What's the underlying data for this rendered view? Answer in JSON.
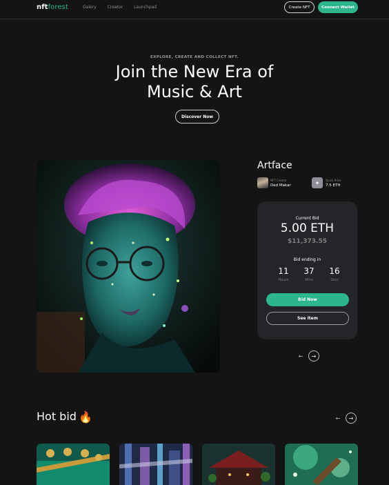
{
  "nav": {
    "logo_main": "nft",
    "logo_accent": "forest",
    "links": [
      "Galery",
      "Creator",
      "Launchpad"
    ],
    "create_label": "Create NFT",
    "wallet_label": "Connect Wallet"
  },
  "hero": {
    "eyebrow": "EXPLORE, CREATE AND COLLECT NFT.",
    "title_line1": "Join the New Era of",
    "title_line2": "Music & Art",
    "discover_label": "Discover Now"
  },
  "artwork": {
    "title": "Artface",
    "creator_role": "NFT Creator",
    "creator_name": "Ded Makar",
    "price_role": "Quick Price",
    "price_value": "7.5 ETH",
    "price_icon": "diamond-icon"
  },
  "bid": {
    "current_label": "Current Bid",
    "eth": "5.00 ETH",
    "usd": "$11,373.55",
    "ending_label": "Bid ending in",
    "timer": [
      {
        "value": "11",
        "unit": "Hours"
      },
      {
        "value": "37",
        "unit": "Mins"
      },
      {
        "value": "16",
        "unit": "Secs"
      }
    ],
    "bid_now_label": "Bid Now",
    "see_item_label": "See Item"
  },
  "hot_bid": {
    "title": "Hot bid",
    "emoji": "🔥"
  },
  "colors": {
    "accent": "#2db58e",
    "background": "#141414",
    "card": "#232528"
  }
}
